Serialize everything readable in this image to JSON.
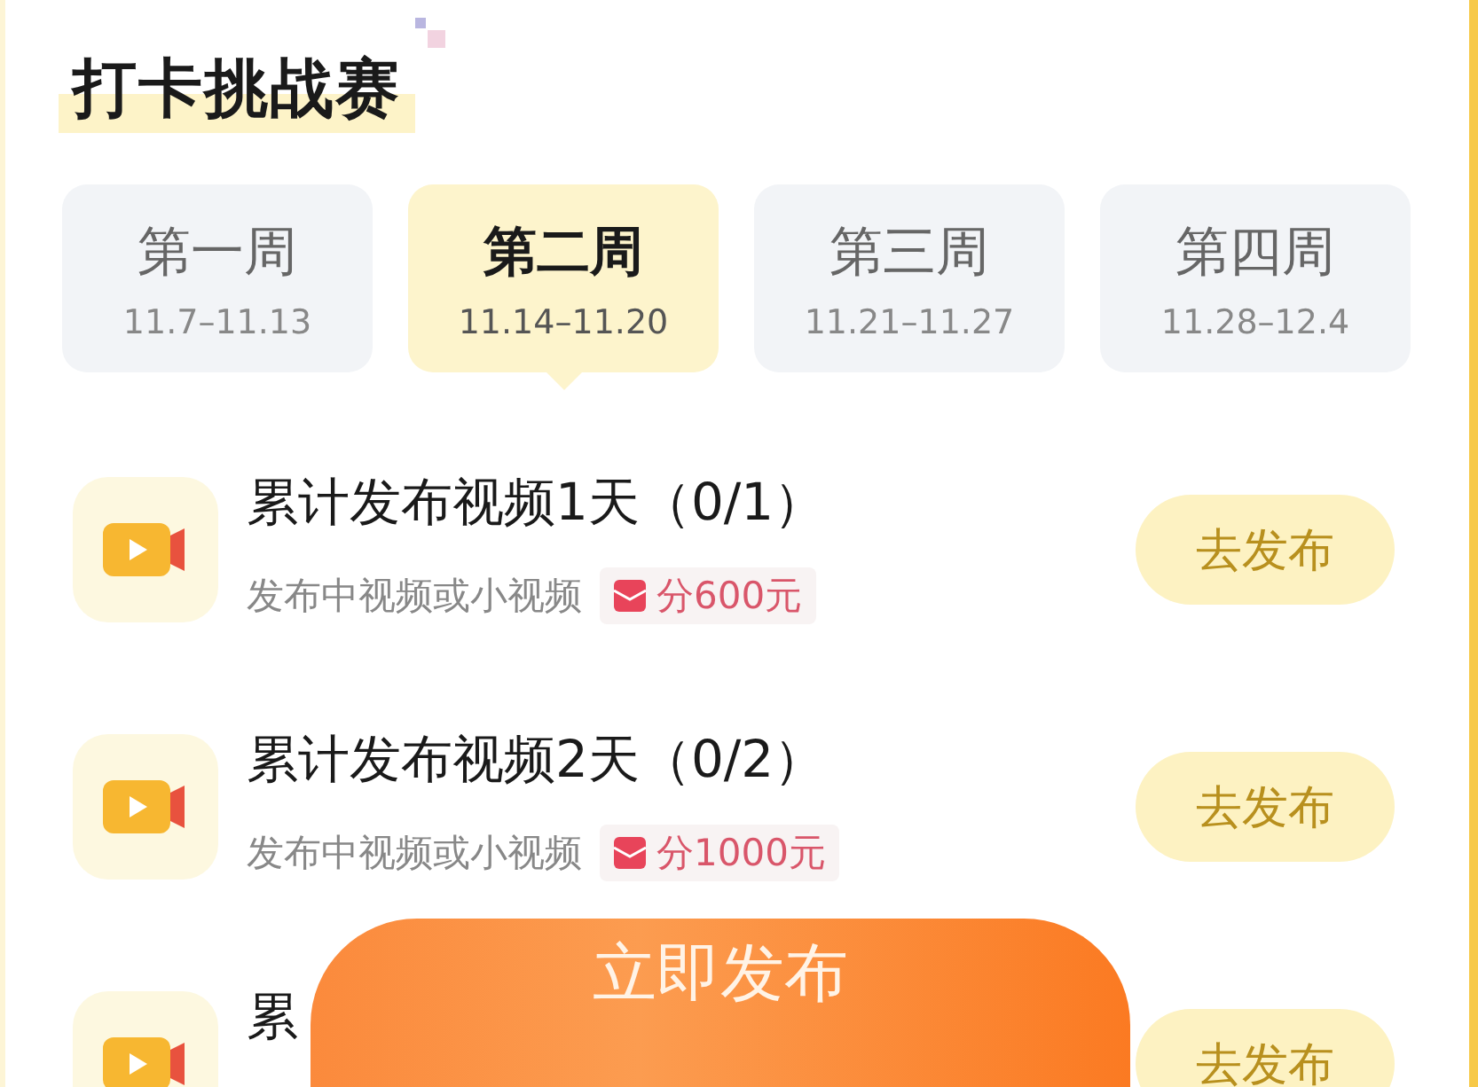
{
  "title": "打卡挑战赛",
  "weeks": [
    {
      "label": "第一周",
      "dates": "11.7–11.13",
      "selected": false
    },
    {
      "label": "第二周",
      "dates": "11.14–11.20",
      "selected": true
    },
    {
      "label": "第三周",
      "dates": "11.21–11.27",
      "selected": false
    },
    {
      "label": "第四周",
      "dates": "11.28–12.4",
      "selected": false
    }
  ],
  "tasks": [
    {
      "title": "累计发布视频1天（0/1）",
      "subtitle": "发布中视频或小视频",
      "reward": "分600元",
      "action": "去发布"
    },
    {
      "title": "累计发布视频2天（0/2）",
      "subtitle": "发布中视频或小视频",
      "reward": "分1000元",
      "action": "去发布"
    },
    {
      "title": "累",
      "action": "去发布"
    }
  ],
  "publish_button": "立即发布"
}
